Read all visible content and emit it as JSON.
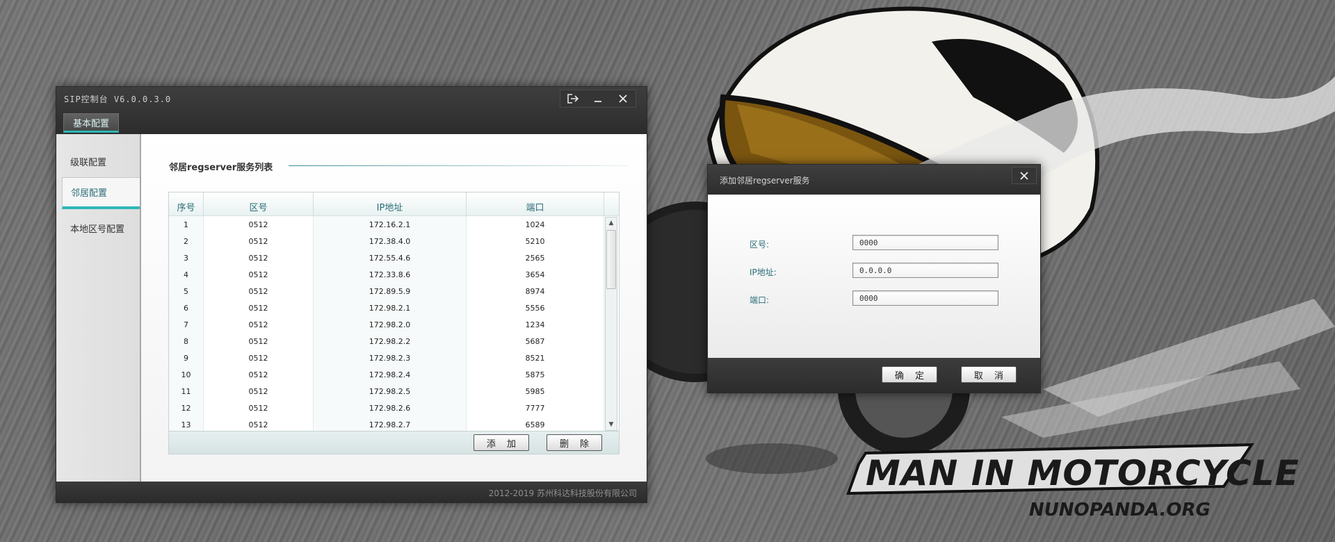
{
  "wallpaper": {
    "logo_line1": "MAN IN MOTORCYCLE",
    "logo_line2": "NUNOPANDA.ORG"
  },
  "main_window": {
    "title": "SIP控制台 V6.0.0.3.0",
    "tab": "基本配置",
    "controls": {
      "logout_icon": "logout-icon",
      "minimize_icon": "minimize-icon",
      "close_icon": "close-icon"
    },
    "sidebar": {
      "items": [
        {
          "label": "级联配置",
          "active": false
        },
        {
          "label": "邻居配置",
          "active": true
        },
        {
          "label": "本地区号配置",
          "active": false
        }
      ]
    },
    "section_title": "邻居regserver服务列表",
    "table": {
      "columns": [
        "序号",
        "区号",
        "IP地址",
        "端口"
      ],
      "rows": [
        [
          "1",
          "0512",
          "172.16.2.1",
          "1024"
        ],
        [
          "2",
          "0512",
          "172.38.4.0",
          "5210"
        ],
        [
          "3",
          "0512",
          "172.55.4.6",
          "2565"
        ],
        [
          "4",
          "0512",
          "172.33.8.6",
          "3654"
        ],
        [
          "5",
          "0512",
          "172.89.5.9",
          "8974"
        ],
        [
          "6",
          "0512",
          "172.98.2.1",
          "5556"
        ],
        [
          "7",
          "0512",
          "172.98.2.0",
          "1234"
        ],
        [
          "8",
          "0512",
          "172.98.2.2",
          "5687"
        ],
        [
          "9",
          "0512",
          "172.98.2.3",
          "8521"
        ],
        [
          "10",
          "0512",
          "172.98.2.4",
          "5875"
        ],
        [
          "11",
          "0512",
          "172.98.2.5",
          "5985"
        ],
        [
          "12",
          "0512",
          "172.98.2.6",
          "7777"
        ],
        [
          "13",
          "0512",
          "172.98.2.7",
          "6589"
        ]
      ]
    },
    "buttons": {
      "add": "添 加",
      "delete": "删 除"
    },
    "copyright": "2012-2019 苏州科达科技股份有限公司"
  },
  "dialog": {
    "title": "添加邻居regserver服务",
    "fields": [
      {
        "label": "区号:",
        "value": "0000"
      },
      {
        "label": "IP地址:",
        "value": "0.0.0.0"
      },
      {
        "label": "端口:",
        "value": "0000"
      }
    ],
    "buttons": {
      "ok": "确 定",
      "cancel": "取 消"
    }
  },
  "colors": {
    "accent": "#2fb7b7",
    "teal_text": "#2a6d77",
    "chrome_dark": "#2c2c2c"
  }
}
